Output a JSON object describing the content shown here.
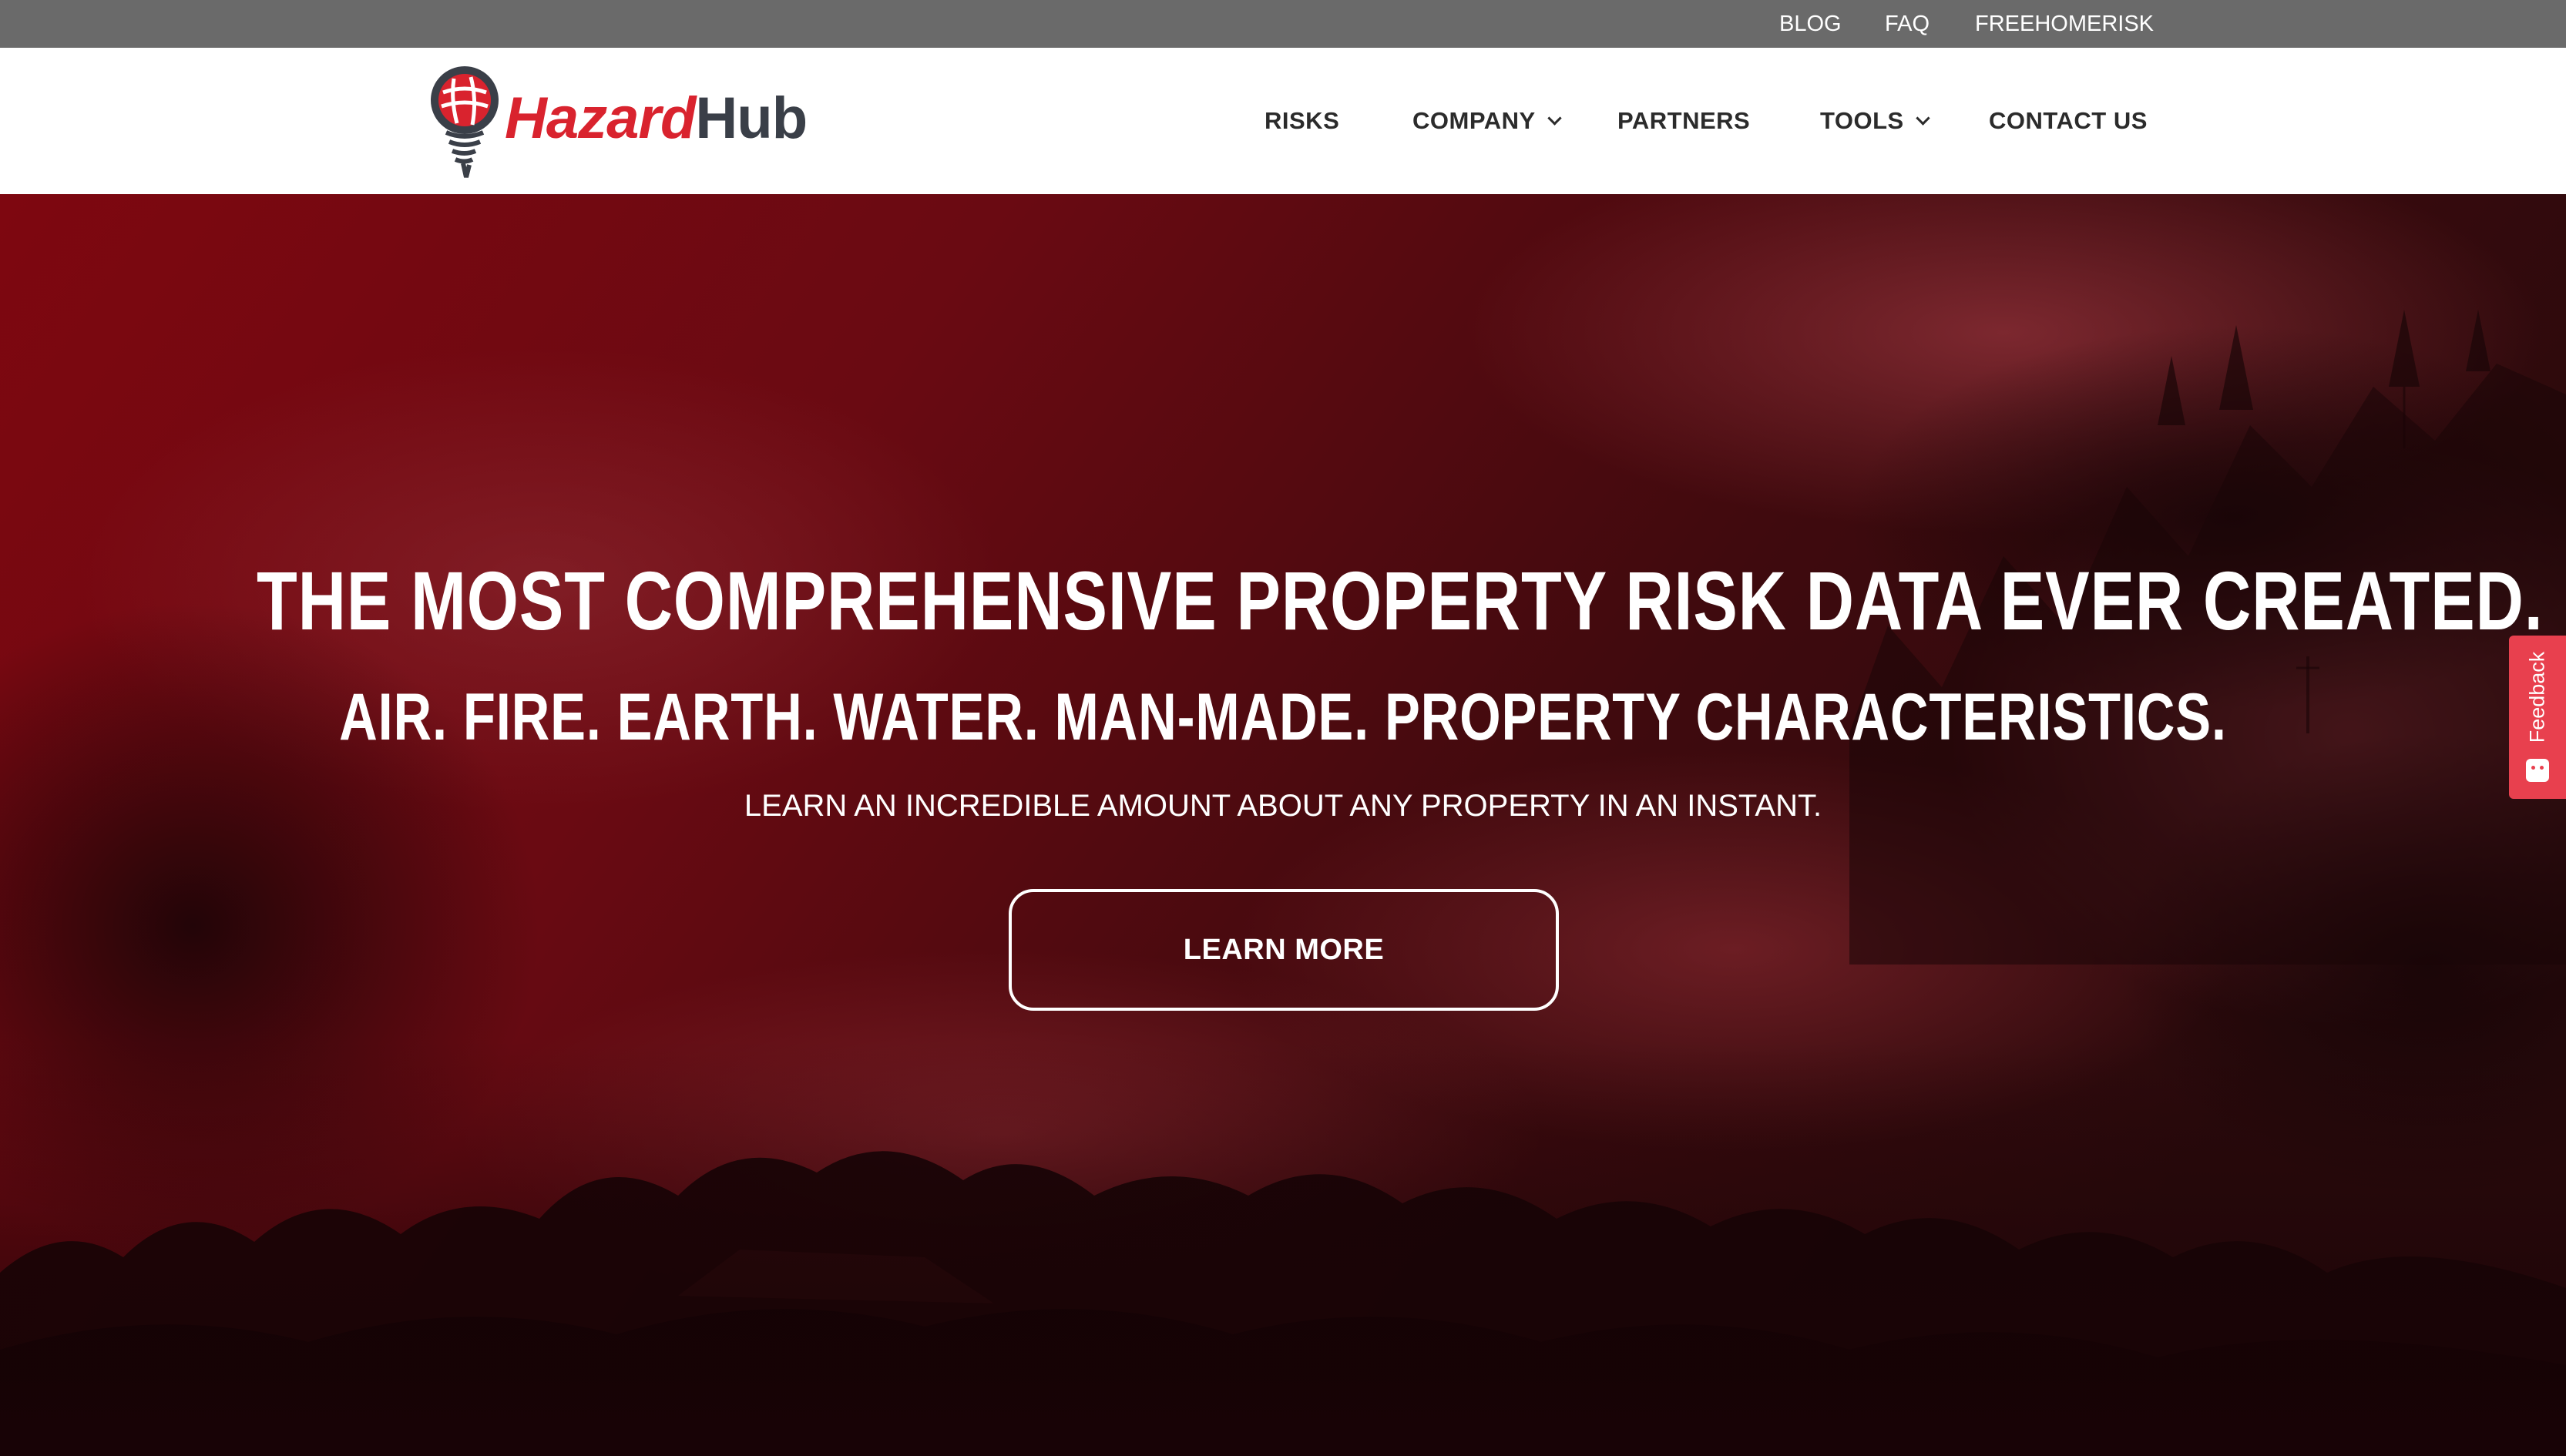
{
  "topbar": {
    "links": [
      {
        "label": "BLOG"
      },
      {
        "label": "FAQ"
      },
      {
        "label": "FREEHOMERISK"
      }
    ]
  },
  "brand": {
    "name_part1": "Hazard",
    "name_part2": "Hub",
    "primary_color": "#d9232e",
    "secondary_color": "#3a3f48"
  },
  "nav": {
    "items": [
      {
        "label": "RISKS",
        "has_dropdown": false
      },
      {
        "label": "COMPANY",
        "has_dropdown": true
      },
      {
        "label": "PARTNERS",
        "has_dropdown": false
      },
      {
        "label": "TOOLS",
        "has_dropdown": true
      },
      {
        "label": "CONTACT US",
        "has_dropdown": false
      }
    ]
  },
  "hero": {
    "headline": "THE MOST COMPREHENSIVE PROPERTY RISK DATA EVER CREATED.",
    "subheadline": "AIR. FIRE. EARTH. WATER. MAN-MADE. PROPERTY CHARACTERISTICS.",
    "tagline": "LEARN AN INCREDIBLE AMOUNT ABOUT ANY PROPERTY IN AN INSTANT.",
    "cta_label": "LEARN MORE",
    "overlay_color": "#8a0a14"
  },
  "feedback": {
    "label": "Feedback",
    "color": "#e8404e"
  }
}
